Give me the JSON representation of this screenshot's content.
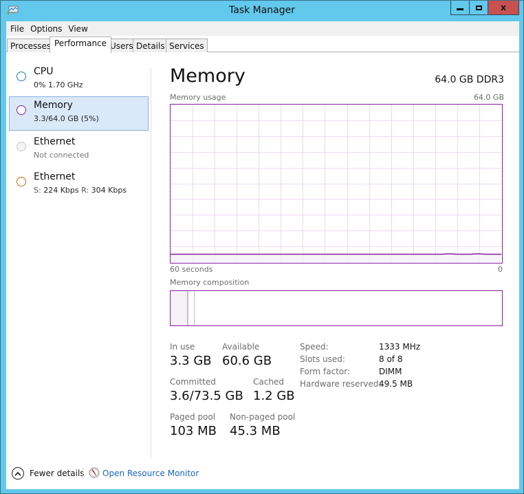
{
  "window": {
    "title": "Task Manager",
    "icon": "task-manager-icon",
    "controls": [
      "minimize",
      "maximize",
      "close"
    ],
    "close_glyph": "x"
  },
  "menu": [
    "File",
    "Options",
    "View"
  ],
  "tabs": [
    {
      "label": "Processes",
      "active": false
    },
    {
      "label": "Performance",
      "active": true
    },
    {
      "label": "Users",
      "active": false
    },
    {
      "label": "Details",
      "active": false
    },
    {
      "label": "Services",
      "active": false
    }
  ],
  "sidebar": {
    "items": [
      {
        "title": "CPU",
        "subtitle": "0% 1.70 GHz",
        "color": "#1a7ac6",
        "selected": false
      },
      {
        "title": "Memory",
        "subtitle": "3.3/64.0 GB (5%)",
        "color": "#8b1ca8",
        "selected": true
      },
      {
        "title": "Ethernet",
        "subtitle": "Not connected",
        "color": "#bdbdbd",
        "selected": false,
        "muted": true
      },
      {
        "title": "Ethernet",
        "send_label": "S:",
        "send_value": "224 Kbps",
        "recv_label": "R:",
        "recv_value": "304 Kbps",
        "color": "#c56a1b",
        "selected": false
      }
    ]
  },
  "main": {
    "title": "Memory",
    "spec": "64.0 GB DDR3",
    "usage_caption": "Memory usage",
    "usage_max": "64.0 GB",
    "time_left": "60 seconds",
    "time_right": "0",
    "usage_fraction": 0.05,
    "composition_caption": "Memory composition",
    "composition": {
      "in_use_fraction": 0.052,
      "modified_fraction": 0.003,
      "standby_fraction": 0.019
    },
    "stats": {
      "in_use_label": "In use",
      "in_use_value": "3.3 GB",
      "available_label": "Available",
      "available_value": "60.6 GB",
      "committed_label": "Committed",
      "committed_value": "3.6/73.5 GB",
      "cached_label": "Cached",
      "cached_value": "1.2 GB",
      "paged_label": "Paged pool",
      "paged_value": "103 MB",
      "nonpaged_label": "Non-paged pool",
      "nonpaged_value": "45.3 MB"
    },
    "details": [
      {
        "key": "Speed:",
        "value": "1333 MHz"
      },
      {
        "key": "Slots used:",
        "value": "8 of 8"
      },
      {
        "key": "Form factor:",
        "value": "DIMM"
      },
      {
        "key": "Hardware reserved:",
        "value": "49.5 MB"
      }
    ]
  },
  "footer": {
    "fewer_details": "Fewer details",
    "open_resource_monitor": "Open Resource Monitor"
  },
  "colors": {
    "accent": "#8b1ca8",
    "grid": "#ecd9f2",
    "fill": "#f4f2f5",
    "link": "#1a66c9",
    "title_bar": "#62c8ec",
    "close_button": "#c75050",
    "selected_bg": "#dae9f8"
  }
}
